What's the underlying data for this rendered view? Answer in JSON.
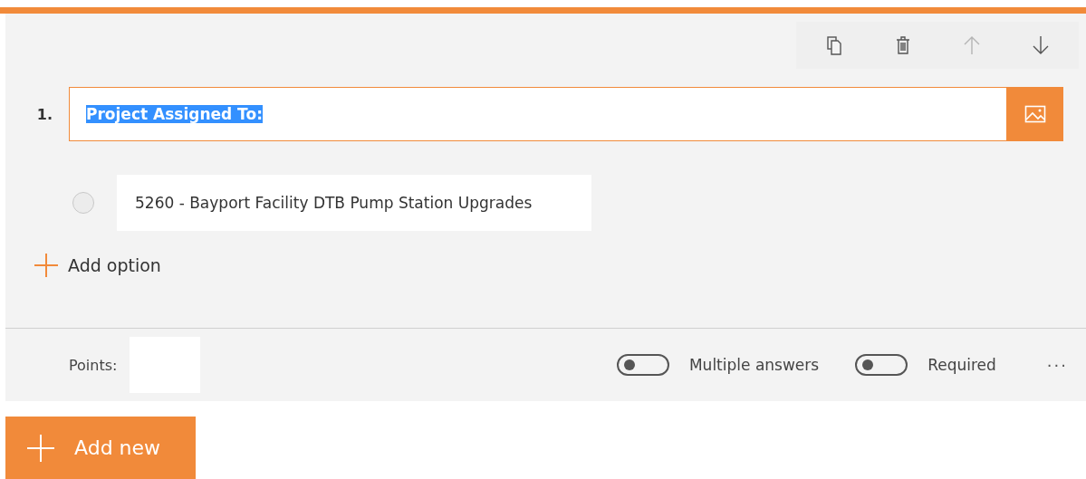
{
  "toolbar": {
    "buttons": [
      {
        "kind": "copy",
        "disabled": false
      },
      {
        "kind": "delete",
        "disabled": false
      },
      {
        "kind": "up",
        "disabled": true
      },
      {
        "kind": "down",
        "disabled": false
      }
    ]
  },
  "question": {
    "number": "1.",
    "title": "Project Assigned To:",
    "title_highlighted": true
  },
  "options": [
    {
      "text": "5260 - Bayport Facility DTB Pump Station Upgrades",
      "selected": false
    }
  ],
  "add_option": "Add option",
  "footer": {
    "points_label": "Points:",
    "toggles": [
      {
        "label": "Multiple answers",
        "on": false
      },
      {
        "label": "Required",
        "on": false
      }
    ],
    "more": "···"
  },
  "add_new": "Add new"
}
